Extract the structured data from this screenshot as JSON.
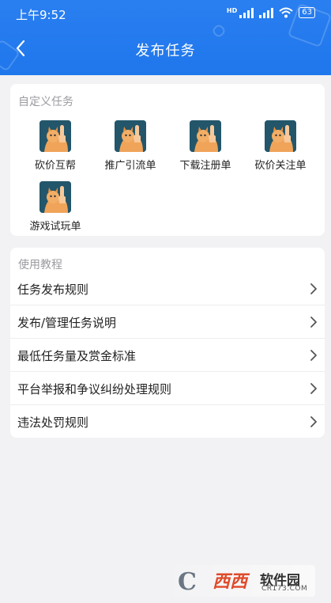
{
  "status_bar": {
    "time": "上午9:52",
    "battery": "63"
  },
  "nav": {
    "title": "发布任务",
    "back_icon": "chevron-left-icon"
  },
  "custom_tasks": {
    "section_title": "自定义任务",
    "items": [
      {
        "label": "砍价互帮",
        "icon": "cat-thumb-icon"
      },
      {
        "label": "推广引流单",
        "icon": "cat-thumb-icon"
      },
      {
        "label": "下载注册单",
        "icon": "cat-thumb-icon"
      },
      {
        "label": "砍价关注单",
        "icon": "cat-thumb-icon"
      },
      {
        "label": "游戏试玩单",
        "icon": "cat-thumb-icon"
      }
    ]
  },
  "guide": {
    "section_title": "使用教程",
    "items": [
      {
        "label": "任务发布规则"
      },
      {
        "label": "发布/管理任务说明"
      },
      {
        "label": "最低任务量及赏金标准"
      },
      {
        "label": "平台举报和争议纠纷处理规则"
      },
      {
        "label": "违法处罚规则"
      }
    ]
  },
  "watermark": {
    "logo": "C",
    "main": "西西",
    "side": "软件园",
    "url": "CR173.COM"
  },
  "colors": {
    "header": "#1f77ec",
    "background": "#f2f2f4",
    "section_title": "#9a9aa0"
  }
}
